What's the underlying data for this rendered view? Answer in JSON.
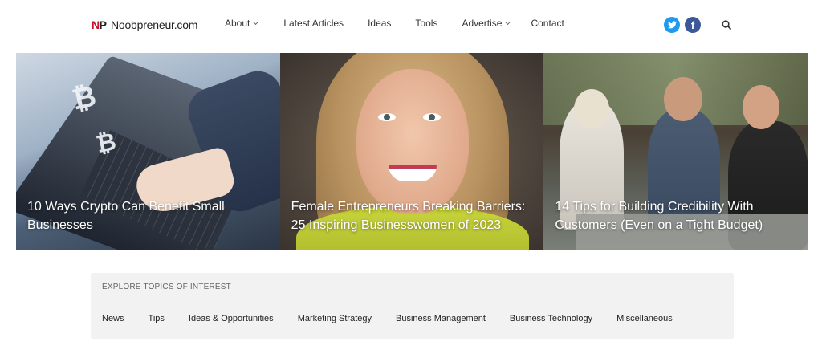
{
  "header": {
    "logo_mark_n": "N",
    "logo_mark_p": "P",
    "logo_text": "Noobpreneur.com",
    "nav": [
      {
        "label": "About",
        "has_dropdown": true
      },
      {
        "label": "Latest Articles",
        "has_dropdown": false
      },
      {
        "label": "Ideas",
        "has_dropdown": false
      },
      {
        "label": "Tools",
        "has_dropdown": false
      },
      {
        "label": "Advertise",
        "has_dropdown": true
      },
      {
        "label": "Contact",
        "has_dropdown": false
      }
    ],
    "social": {
      "twitter_icon": "twitter-icon",
      "facebook_icon": "facebook-icon",
      "twitter_color": "#1d9bf0",
      "facebook_color": "#3b5998"
    },
    "search_icon": "search-icon"
  },
  "hero": {
    "cards": [
      {
        "title": "10 Ways Crypto Can Benefit Small Businesses"
      },
      {
        "title": "Female Entrepreneurs Breaking Barriers: 25 Inspiring Businesswomen of 2023"
      },
      {
        "title": "14 Tips for Building Credibility With Customers (Even on a Tight Budget)"
      }
    ]
  },
  "topics": {
    "label": "EXPLORE TOPICS OF INTEREST",
    "items": [
      "News",
      "Tips",
      "Ideas & Opportunities",
      "Marketing Strategy",
      "Business Management",
      "Business Technology",
      "Miscellaneous"
    ]
  }
}
